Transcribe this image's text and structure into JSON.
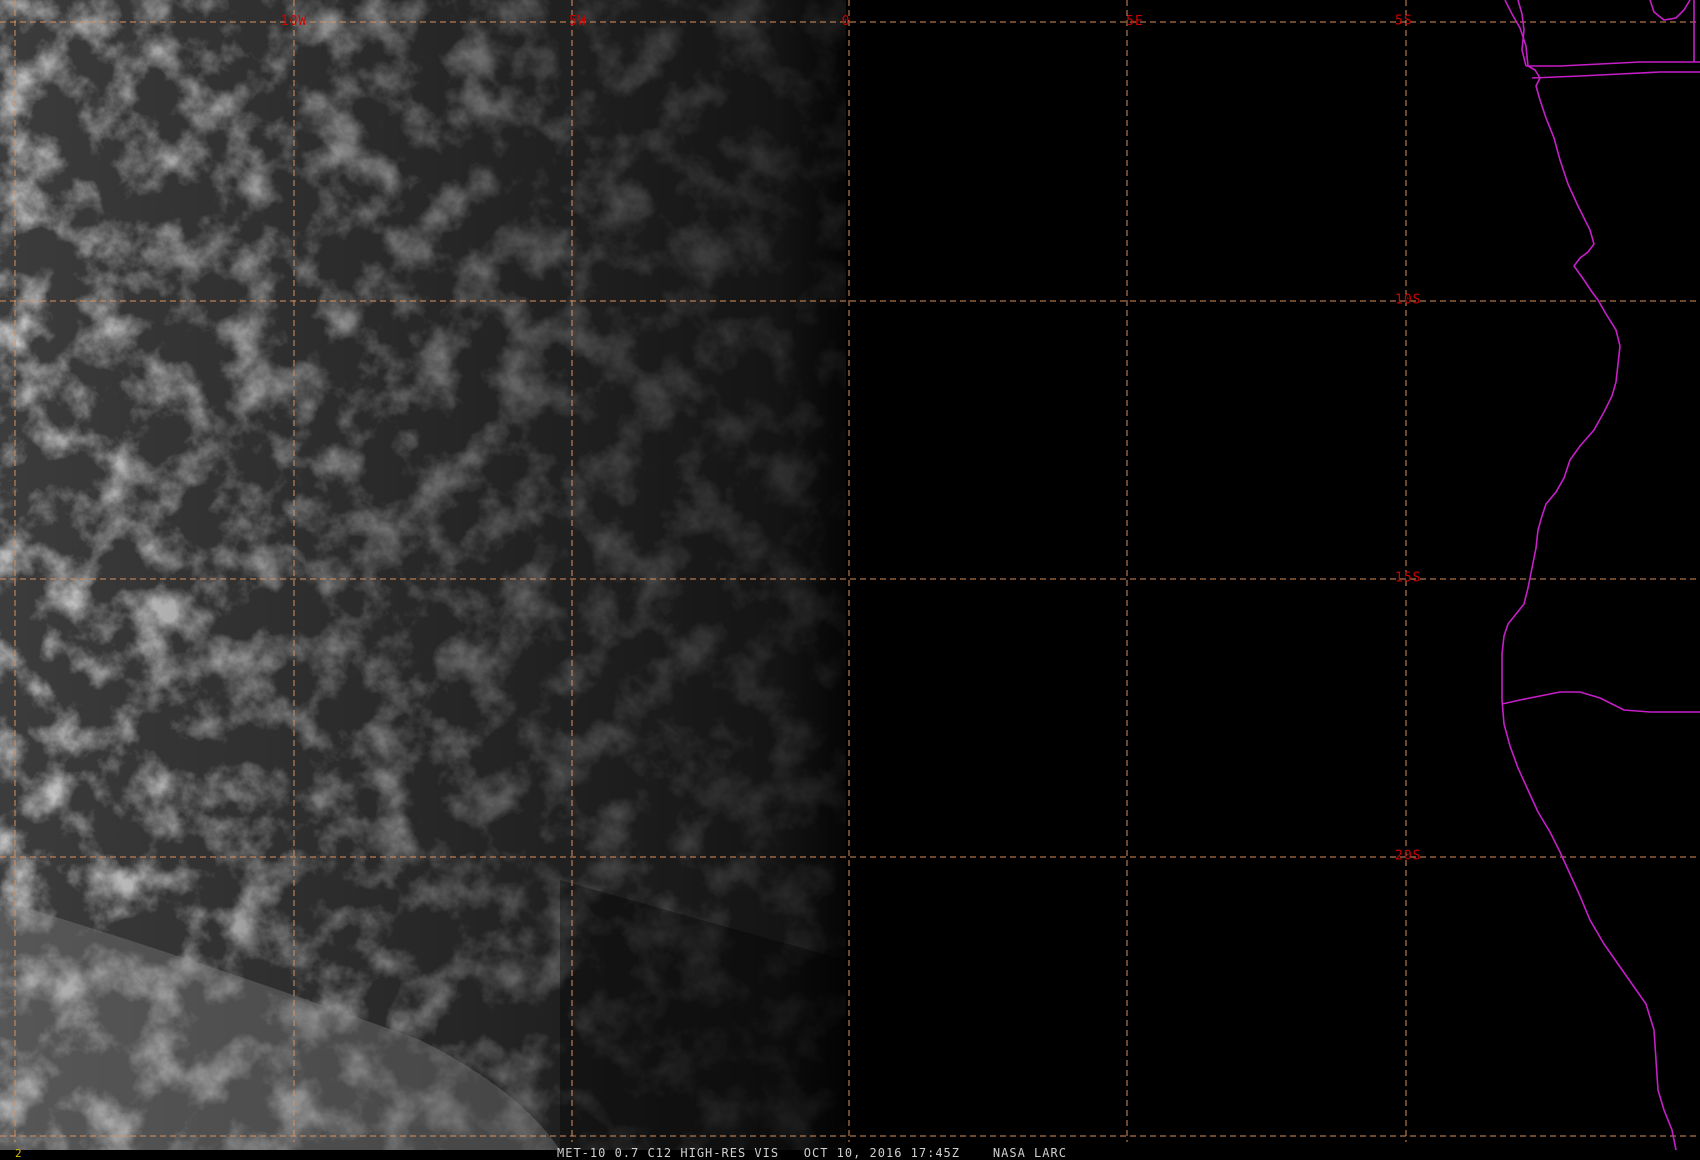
{
  "product": {
    "caption": "MET-10 0.7 C12 HIGH-RES VIS   OCT 10, 2016 17:45Z    NASA LARC",
    "frame_number": "2"
  },
  "graticule": {
    "longitude_labels": [
      "10W",
      "5W",
      "0",
      "5E"
    ],
    "latitude_labels": [
      "5S",
      "10S",
      "15S",
      "20S"
    ]
  },
  "colors": {
    "background": "#000000",
    "grid_line": "#d9915e",
    "grid_label": "#d10000",
    "coastline": "#c61ec8",
    "caption_text": "#cfcfcf",
    "frame_number_text": "#d6c000"
  }
}
